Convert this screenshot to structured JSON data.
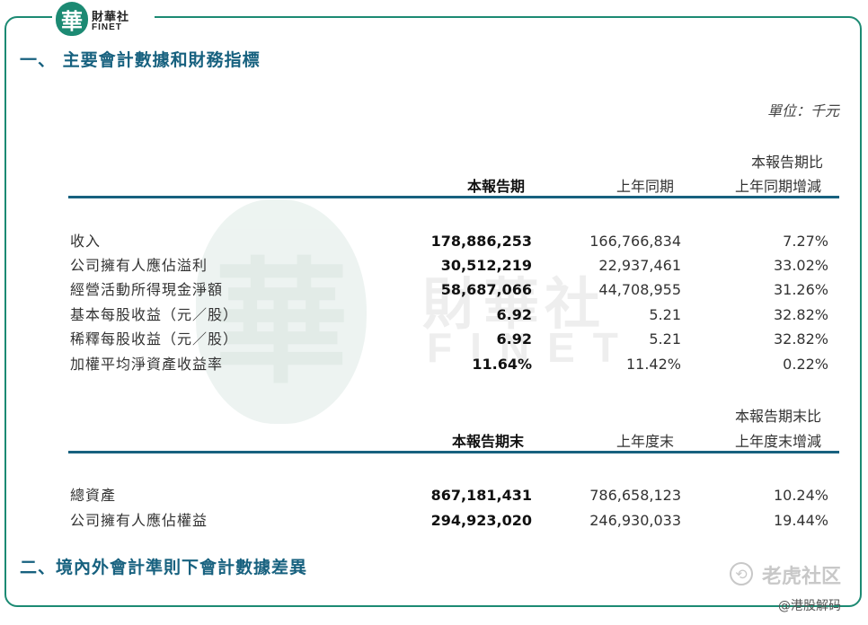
{
  "logo": {
    "glyph": "華",
    "name_cn": "財華社",
    "name_en": "FINET"
  },
  "section1": {
    "title": "一、 主要會計數據和財務指標"
  },
  "unit": "單位：千元",
  "table1": {
    "headers": {
      "current": "本報告期",
      "previous": "上年同期",
      "change_line1": "本報告期比",
      "change_line2": "上年同期增減"
    },
    "rows": [
      {
        "label": "收入",
        "current": "178,886,253",
        "previous": "166,766,834",
        "change": "7.27%"
      },
      {
        "label": "公司擁有人應佔溢利",
        "current": "30,512,219",
        "previous": "22,937,461",
        "change": "33.02%"
      },
      {
        "label": "經營活動所得現金淨額",
        "current": "58,687,066",
        "previous": "44,708,955",
        "change": "31.26%"
      },
      {
        "label": "基本每股收益（元／股）",
        "current": "6.92",
        "previous": "5.21",
        "change": "32.82%"
      },
      {
        "label": "稀釋每股收益（元／股）",
        "current": "6.92",
        "previous": "5.21",
        "change": "32.82%"
      },
      {
        "label": "加權平均淨資產收益率",
        "current": "11.64%",
        "previous": "11.42%",
        "change": "0.22%"
      }
    ]
  },
  "table2": {
    "headers": {
      "current": "本報告期末",
      "previous": "上年度末",
      "change_line1": "本報告期末比",
      "change_line2": "上年度末增減"
    },
    "rows": [
      {
        "label": "總資產",
        "current": "867,181,431",
        "previous": "786,658,123",
        "change": "10.24%"
      },
      {
        "label": "公司擁有人應佔權益",
        "current": "294,923,020",
        "previous": "246,930,033",
        "change": "19.44%"
      }
    ]
  },
  "section2": {
    "title": "二、境內外會計準則下會計數據差異"
  },
  "watermark": {
    "glyph": "華",
    "name_cn": "財華社",
    "name_en": "FINET"
  },
  "tiger_watermark": {
    "text": "老虎社区",
    "icon": "tiger-logo-icon"
  },
  "weibo_watermark": {
    "text": "@港股解码"
  },
  "colors": {
    "accent": "#1c8a73",
    "title": "#17617f",
    "rule": "#17617f"
  }
}
